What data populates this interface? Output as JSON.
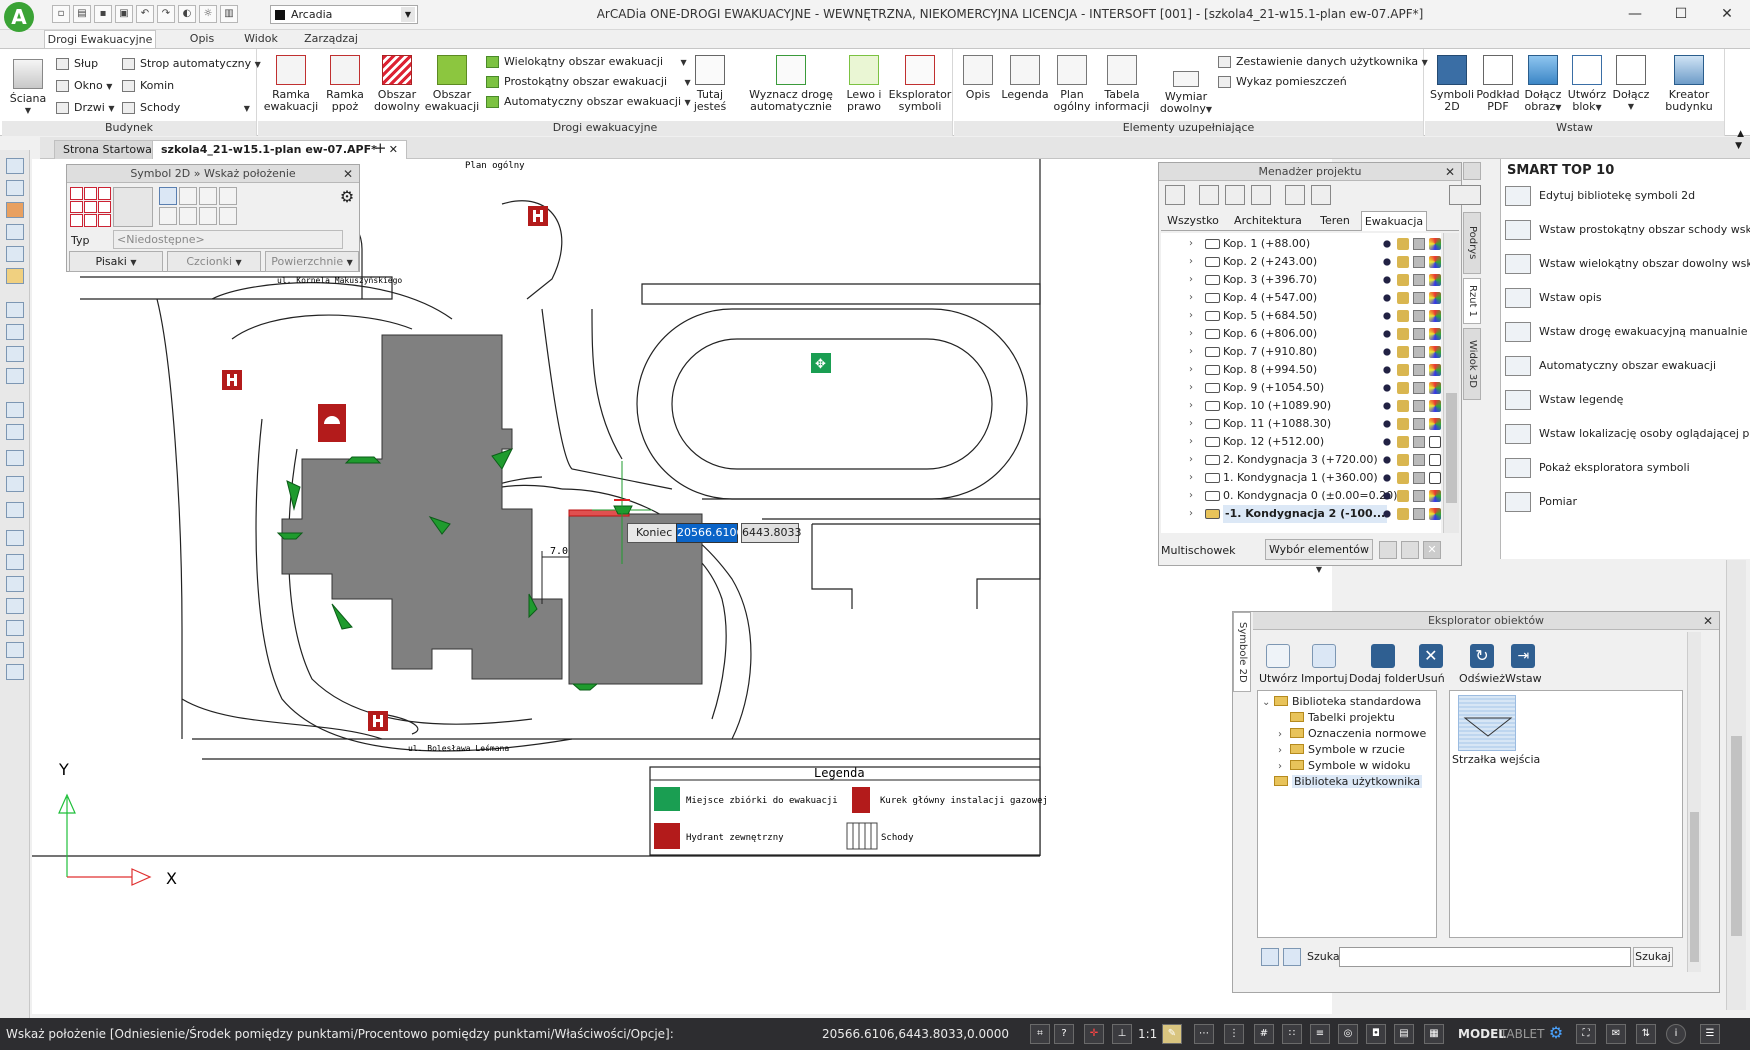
{
  "app": {
    "logo_letter": "A",
    "window_title": "ArCADia ONE-DROGI EWAKUACYJNE - WEWNĘTRZNA, NIEKOMERCYJNA LICENCJA - INTERSOFT [001] - [szkola4_21-w15.1-plan ew-07.APF*]",
    "layer_name": "Arcadia",
    "window_controls": [
      "—",
      "☐",
      "✕"
    ]
  },
  "ribbon": {
    "tabs": [
      "Drogi Ewakuacyjne",
      "Opis",
      "Widok",
      "Zarządzaj"
    ],
    "active_tab": "Drogi Ewakuacyjne",
    "groups": {
      "budynek": {
        "title": "Budynek",
        "big": "Ściana",
        "small": [
          "Słup",
          "Okno",
          "Drzwi",
          "Strop automatyczny",
          "Komin",
          "Schody"
        ]
      },
      "drogi": {
        "title": "Drogi ewakuacyjne",
        "big": [
          {
            "l1": "Ramka",
            "l2": "ewakuacji"
          },
          {
            "l1": "Ramka",
            "l2": "ppoż"
          },
          {
            "l1": "Obszar",
            "l2": "dowolny"
          },
          {
            "l1": "Obszar",
            "l2": "ewakuacji"
          },
          {
            "l1": "Tutaj",
            "l2": "jesteś"
          },
          {
            "l1": "Wyznacz drogę",
            "l2": "automatycznie"
          },
          {
            "l1": "Lewo i",
            "l2": "prawo"
          },
          {
            "l1": "Eksplorator",
            "l2": "symboli"
          }
        ],
        "small": [
          "Wielokątny obszar ewakuacji",
          "Prostokątny obszar ewakuacji",
          "Automatyczny obszar ewakuacji"
        ]
      },
      "elementy": {
        "title": "Elementy uzupełniające",
        "big": [
          {
            "l1": "Opis",
            "l2": ""
          },
          {
            "l1": "Legenda",
            "l2": ""
          },
          {
            "l1": "Plan",
            "l2": "ogólny"
          },
          {
            "l1": "Tabela",
            "l2": "informacji"
          },
          {
            "l1": "Wymiar",
            "l2": "dowolny"
          }
        ],
        "small": [
          "Zestawienie danych użytkownika",
          "Wykaz pomieszczeń"
        ]
      },
      "wstaw": {
        "title": "Wstaw",
        "big": [
          {
            "l1": "Symboli",
            "l2": "2D"
          },
          {
            "l1": "Podkład",
            "l2": "PDF"
          },
          {
            "l1": "Dołącz",
            "l2": "obraz"
          },
          {
            "l1": "Utwórz",
            "l2": "blok"
          },
          {
            "l1": "Dołącz",
            "l2": ""
          },
          {
            "l1": "Kreator",
            "l2": "budynku"
          }
        ]
      }
    }
  },
  "doc_tabs": [
    "Strona Startowa",
    "szkola4_21-w15.1-plan ew-07.APF*"
  ],
  "symbol_panel": {
    "title": "Symbol 2D » Wskaż położenie",
    "type_label": "Typ",
    "type_value": "<Niedostępne>",
    "buttons": [
      "Pisaki",
      "Czcionki",
      "Powierzchnie"
    ]
  },
  "project_manager": {
    "title": "Menadżer projektu",
    "tabs": [
      "Wszystko",
      "Architektura",
      "Teren",
      "Ewakuacja"
    ],
    "active_tab": "Ewakuacja",
    "levels": [
      "Kop. 1 (+88.00)",
      "Kop. 2 (+243.00)",
      "Kop. 3 (+396.70)",
      "Kop. 4 (+547.00)",
      "Kop. 5 (+684.50)",
      "Kop. 6 (+806.00)",
      "Kop. 7 (+910.80)",
      "Kop. 8 (+994.50)",
      "Kop. 9 (+1054.50)",
      "Kop. 10 (+1089.90)",
      "Kop. 11 (+1088.30)",
      "Kop. 12 (+512.00)",
      "2. Kondygnacja 3 (+720.00)",
      "1. Kondygnacja 1 (+360.00)",
      "0. Kondygnacja 0 (±0.00=0.20)",
      "-1. Kondygnacja 2 (-100..."
    ],
    "multischowek_label": "Multischowek",
    "select_label": "Wybór elementów",
    "side_tabs": [
      "Podrys",
      "Rzut 1",
      "Widok 3D"
    ]
  },
  "smart_top": {
    "title": "SMART TOP 10",
    "items": [
      "Edytuj bibliotekę symboli 2d",
      "Wstaw prostokątny obszar schody wskaz...",
      "Wstaw wielokątny obszar dowolny wskaz...",
      "Wstaw opis",
      "Wstaw drogę ewakuacyjną manualnie",
      "Automatyczny obszar ewakuacji",
      "Wstaw legendę",
      "Wstaw lokalizację osoby oglądającej plan",
      "Pokaż eksploratora symboli",
      "Pomiar"
    ]
  },
  "explorer": {
    "title": "Eksplorator obiektów",
    "side_tab": "Symbole 2D",
    "buttons": [
      "Utwórz",
      "Importuj",
      "Dodaj folder",
      "Usuń",
      "Odśwież",
      "Wstaw"
    ],
    "tree": [
      {
        "label": "Biblioteka standardowa",
        "level": 0,
        "expanded": true
      },
      {
        "label": "Tabelki projektu",
        "level": 1
      },
      {
        "label": "Oznaczenia normowe",
        "level": 1
      },
      {
        "label": "Symbole w rzucie",
        "level": 1
      },
      {
        "label": "Symbole w widoku",
        "level": 1
      },
      {
        "label": "Biblioteka użytkownika",
        "level": 0,
        "selected": true
      }
    ],
    "preview_label": "Strzałka wejścia",
    "search_label": "Szukaj:",
    "search_value": "",
    "search_button": "Szukaj"
  },
  "drawing": {
    "plan_title": "Plan ogólny",
    "street_top": "ul. Kornela Makuszyńskiego",
    "street_bottom": "ul. Bolesława Leśmana",
    "dimension_label": "7.0",
    "gas_sign_text": "Kurek główny instalacji gazowej",
    "axis_y": "Y",
    "axis_x": "X",
    "legend_title": "Legenda",
    "legend_items": [
      "Miejsce zbiórki do ewakuacji",
      "Kurek główny instalacji gazowej",
      "Hydrant zewnętrzny",
      "Schody"
    ],
    "input_prompt": "Koniec",
    "input_x": "20566.6106",
    "input_y": "6443.8033"
  },
  "status": {
    "prompt": "Wskaż położenie [Odniesienie/Środek pomiędzy punktami/Procentowo pomiędzy punktami/Właściwości/Opcje]:",
    "coords": "20566.6106,6443.8033,0.0000",
    "scale": "1:1",
    "mode1": "MODEL",
    "mode2": "TABLET"
  },
  "colors": {
    "accent": "#3aa335",
    "building": "#808080",
    "exit_green": "#1f9b2e",
    "hydrant_red": "#b31b1b",
    "statusbar": "#2d2d30",
    "highlight": "#0a64c8"
  }
}
